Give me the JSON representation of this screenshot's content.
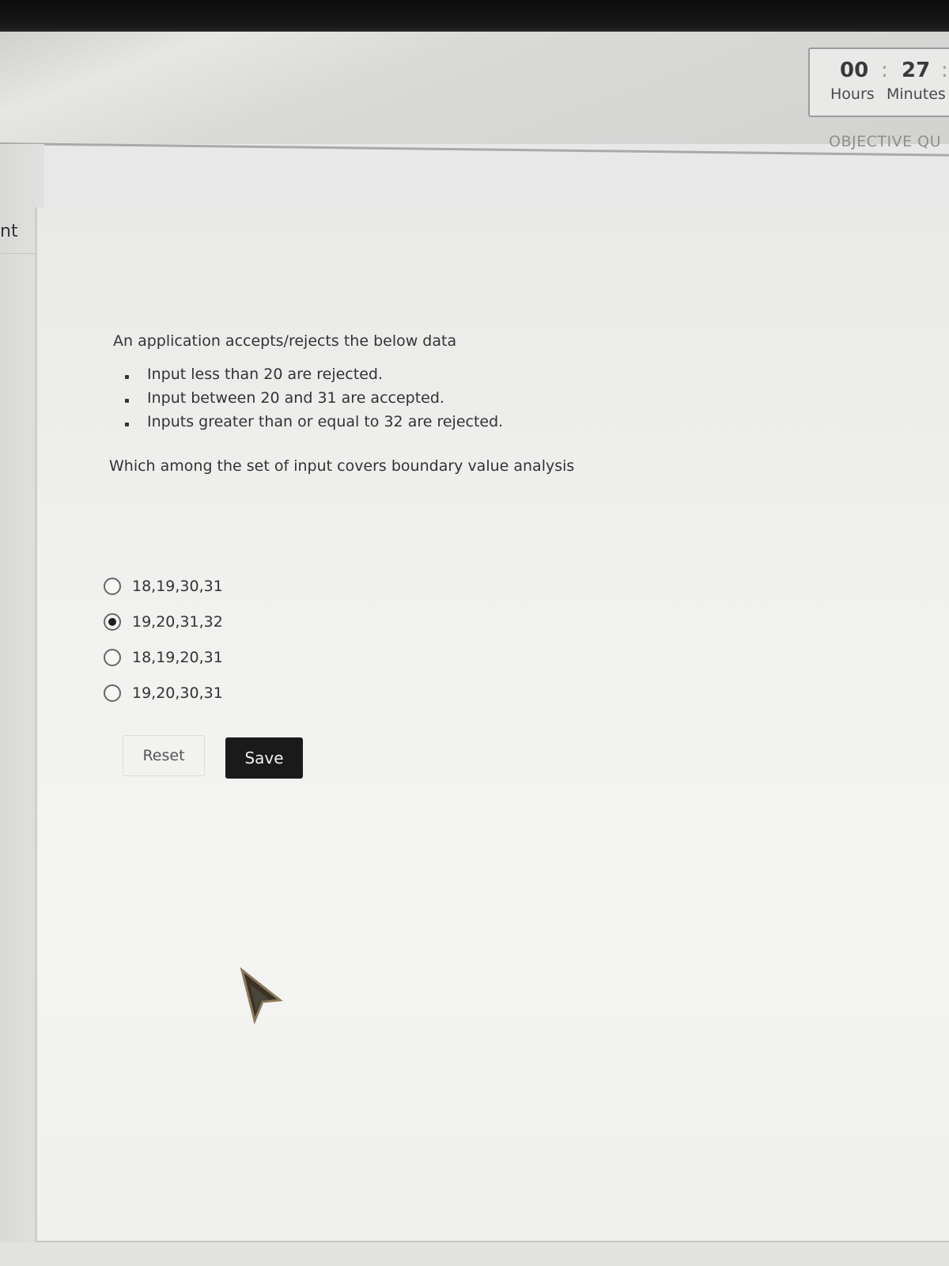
{
  "header": {
    "timer": {
      "hours": "00",
      "minutes": "27",
      "separator": ":",
      "hours_label": "Hours",
      "minutes_label": "Minutes"
    },
    "section_title": "OBJECTIVE QU"
  },
  "sidebar": {
    "stub_label": "nt"
  },
  "question": {
    "intro": "An application accepts/rejects the below data",
    "conditions": [
      "Input less than 20 are rejected.",
      "Input between 20 and 31 are accepted.",
      "Inputs greater than or equal to 32 are rejected."
    ],
    "prompt": "Which among the set of input covers boundary value analysis"
  },
  "options": [
    {
      "label": "18,19,30,31",
      "selected": false
    },
    {
      "label": "19,20,31,32",
      "selected": true
    },
    {
      "label": "18,19,20,31",
      "selected": false
    },
    {
      "label": "19,20,30,31",
      "selected": false
    }
  ],
  "actions": {
    "reset_label": "Reset",
    "save_label": "Save"
  },
  "colors": {
    "save_button_bg": "#1a1a1a",
    "page_bg": "#f1f1ef"
  }
}
